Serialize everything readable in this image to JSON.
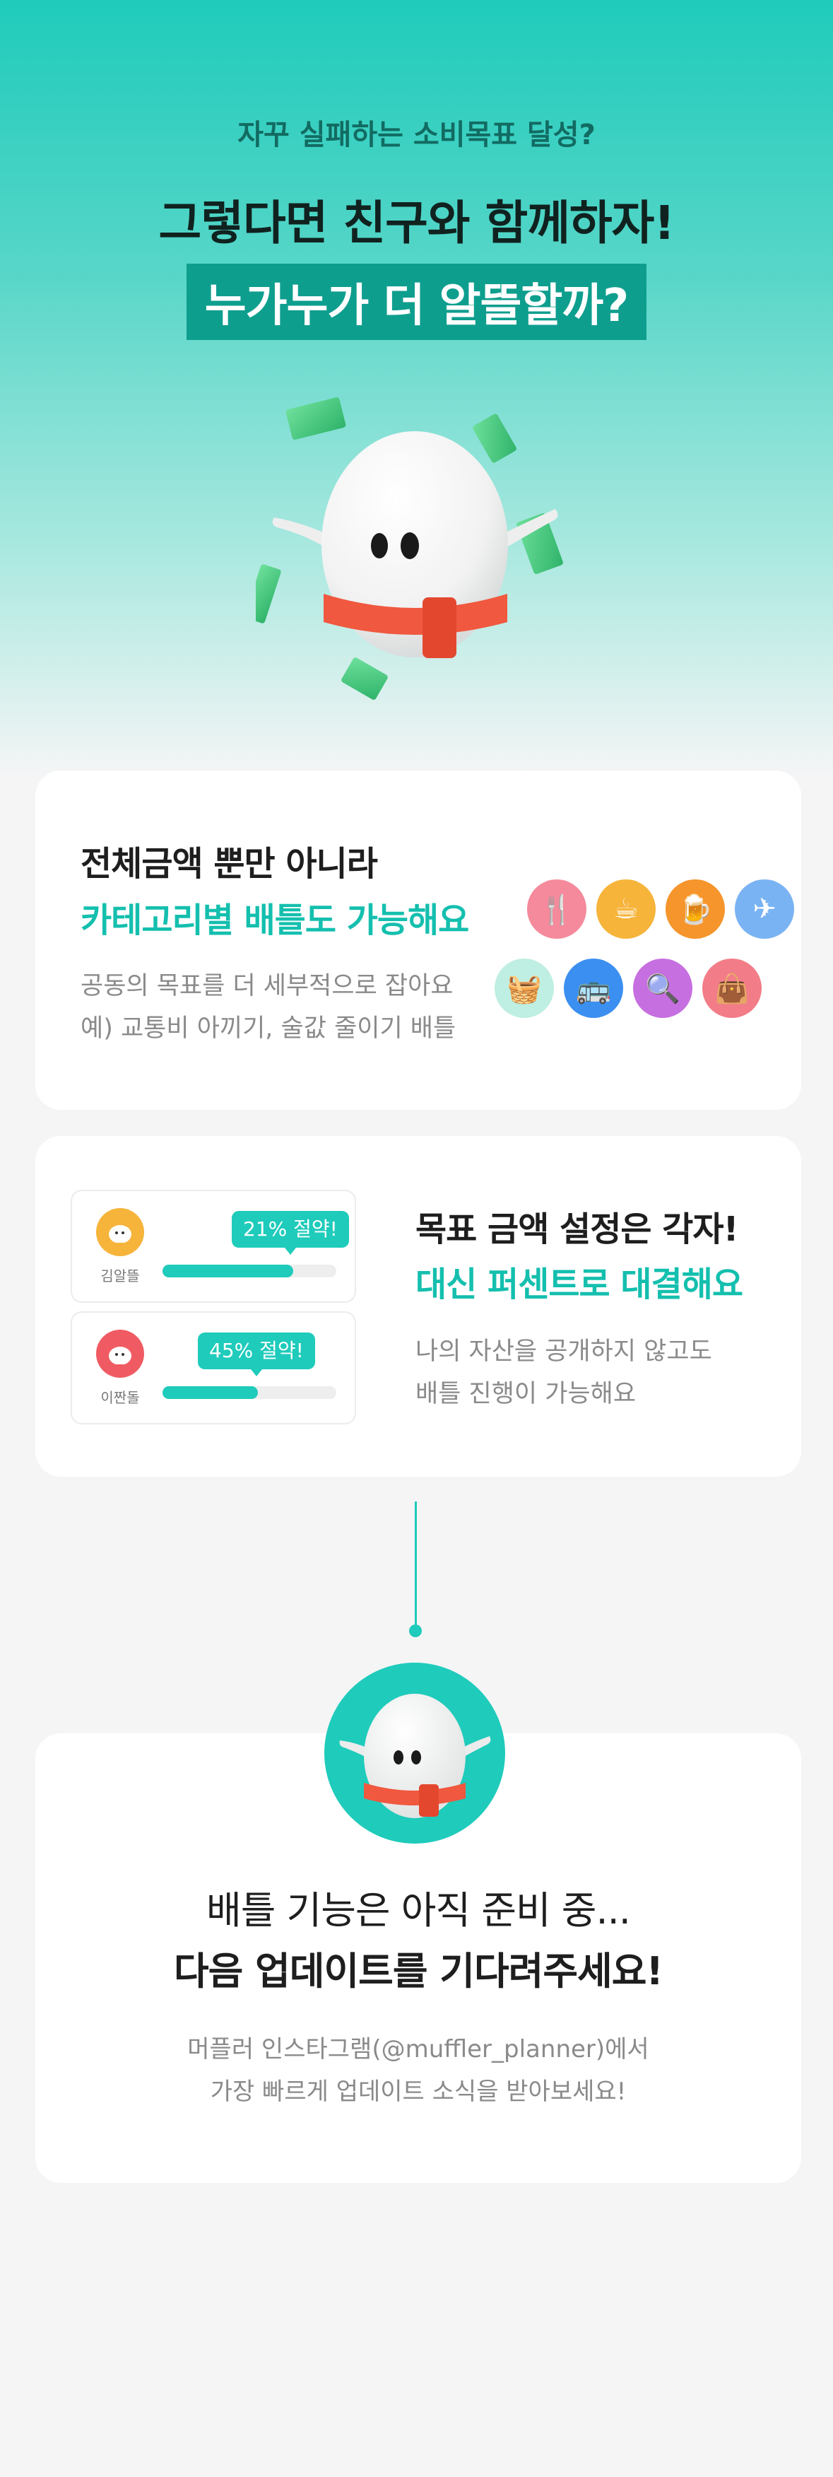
{
  "hero": {
    "subtitle": "자꾸 실패하는 소비목표 달성?",
    "title": "그렇다면 친구와 함께하자!",
    "highlight": "누가누가 더 알뜰할까?"
  },
  "card_category": {
    "title": "전체금액 뿐만 아니라",
    "accent": "카테고리별 배틀도 가능해요",
    "desc_line1": "공동의 목표를 더 세부적으로 잡아요",
    "desc_line2": "예) 교통비 아끼기, 술값 줄이기 배틀",
    "icons": [
      {
        "name": "restaurant-icon",
        "color": "#f48a9b",
        "glyph": "🍴"
      },
      {
        "name": "coffee-icon",
        "color": "#f6b43b",
        "glyph": "☕"
      },
      {
        "name": "beer-icon",
        "color": "#f5952c",
        "glyph": "🍺"
      },
      {
        "name": "airplane-icon",
        "color": "#7ab3f3",
        "glyph": "✈"
      },
      {
        "name": "basket-icon",
        "color": "#9fe0cf",
        "glyph": "🧺"
      },
      {
        "name": "bus-icon",
        "color": "#3b8ff0",
        "glyph": "🚌"
      },
      {
        "name": "magnifier-icon",
        "color": "#c66fe0",
        "glyph": "🔍"
      },
      {
        "name": "shopping-bag-icon",
        "color": "#f27d88",
        "glyph": "👜"
      }
    ]
  },
  "card_goal": {
    "title": "목표 금액 설정은 각자!",
    "accent": "대신 퍼센트로 대결해요",
    "desc_line1": "나의 자산을 공개하지 않고도",
    "desc_line2": "배틀 진행이 가능해요",
    "players": [
      {
        "name": "김알뜰",
        "badge": "21% 절약!",
        "progress": 0.75,
        "avatar_color": "#f6b43b"
      },
      {
        "name": "이짠돌",
        "badge": "45% 절약!",
        "progress": 0.55,
        "avatar_color": "#f05b63"
      }
    ]
  },
  "card_coming": {
    "title": "배틀 기능은 아직 준비 중...",
    "title_bold": "다음 업데이트를 기다려주세요!",
    "desc_line1": "머플러 인스타그램(@muffler_planner)에서",
    "desc_line2": "가장 빠르게 업데이트 소식을 받아보세요!"
  },
  "colors": {
    "accent": "#1fcbbb",
    "accent_dark": "#0e9e8e"
  }
}
